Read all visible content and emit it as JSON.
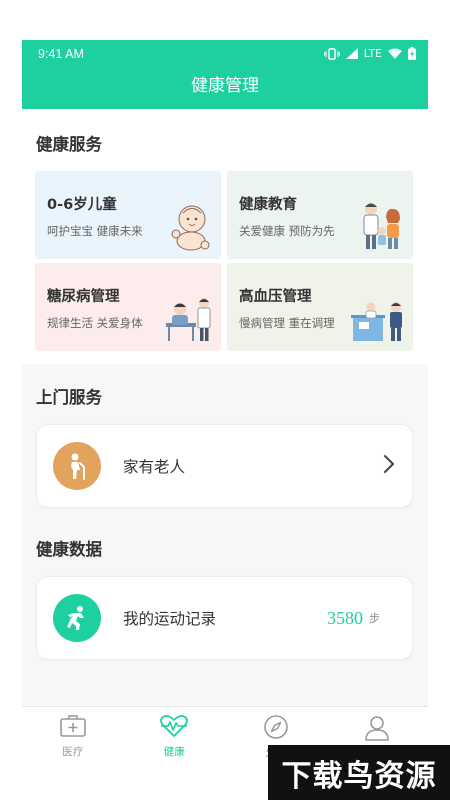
{
  "status_bar": {
    "time": "9:41 AM",
    "network": "LTE"
  },
  "header": {
    "title": "健康管理"
  },
  "health_services": {
    "title": "健康服务",
    "cards": [
      {
        "title": "0-6岁儿童",
        "subtitle": "呵护宝宝 健康未来",
        "icon": "baby-illustration"
      },
      {
        "title": "健康教育",
        "subtitle": "关爱健康 预防为先",
        "icon": "doctor-family-illustration"
      },
      {
        "title": "糖尿病管理",
        "subtitle": "规律生活 关爱身体",
        "icon": "patient-doctor-illustration"
      },
      {
        "title": "高血压管理",
        "subtitle": "慢病管理 重在调理",
        "icon": "clinic-consultation-illustration"
      }
    ]
  },
  "home_services": {
    "title": "上门服务",
    "item": {
      "label": "家有老人",
      "icon": "elderly-icon",
      "chevron": "chevron-right-icon"
    }
  },
  "health_data": {
    "title": "健康数据",
    "item": {
      "label": "我的运动记录",
      "icon": "running-icon",
      "steps": "3580",
      "unit": "步"
    }
  },
  "tabbar": {
    "tabs": [
      {
        "label": "医疗",
        "icon": "medical-kit-icon",
        "active": false
      },
      {
        "label": "健康",
        "icon": "heartbeat-icon",
        "active": true
      },
      {
        "label": "发现",
        "icon": "compass-icon",
        "active": false
      },
      {
        "label": "",
        "icon": "user-icon",
        "active": false
      }
    ]
  },
  "watermark": {
    "text": "下载鸟资源"
  },
  "colors": {
    "accent": "#1ecf9f",
    "elderly_icon_bg": "#e2a45c",
    "card_blue": "#eaf4fc",
    "card_green": "#ebf4ef",
    "card_pink": "#fcecec",
    "card_olive": "#eff3ea"
  }
}
